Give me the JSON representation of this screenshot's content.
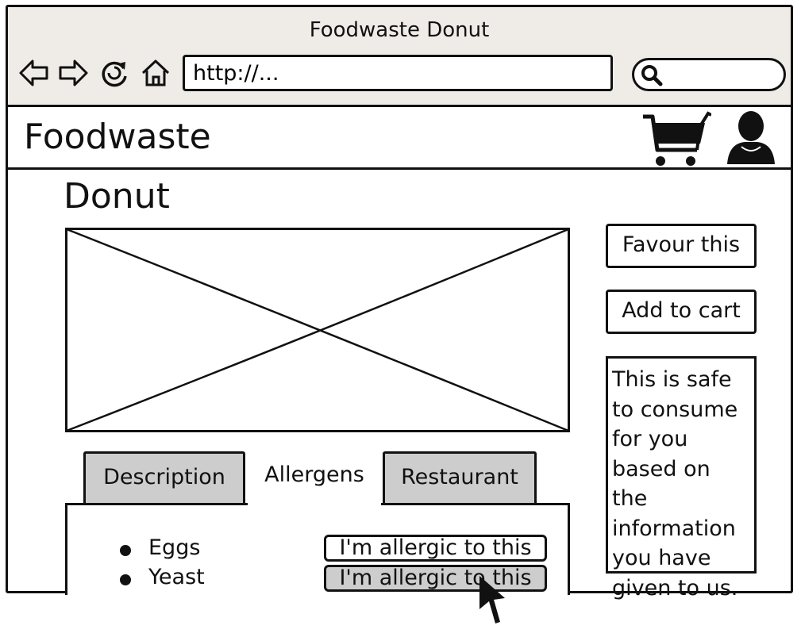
{
  "window": {
    "title": "Foodwaste Donut",
    "address_value": "http://...",
    "search_value": ""
  },
  "app": {
    "brand": "Foodwaste"
  },
  "product": {
    "title": "Donut",
    "favour_label": "Favour this",
    "add_to_cart_label": "Add to cart",
    "safe_note_lines": [
      "This is safe",
      "to consume",
      "for you",
      "based on the",
      "information",
      "you have",
      "given to us."
    ]
  },
  "tabs": [
    {
      "label": "Description",
      "active": false
    },
    {
      "label": "Allergens",
      "active": true
    },
    {
      "label": "Restaurant",
      "active": false
    }
  ],
  "allergens": [
    {
      "name": "Eggs",
      "button_label": "I'm allergic to this",
      "selected": false
    },
    {
      "name": "Yeast",
      "button_label": "I'm allergic to this",
      "selected": true
    }
  ],
  "colors": {
    "chrome": "#efebe7",
    "tab_inactive": "#cdcdcd",
    "button_selected": "#cdcdcd",
    "ink": "#111111"
  }
}
